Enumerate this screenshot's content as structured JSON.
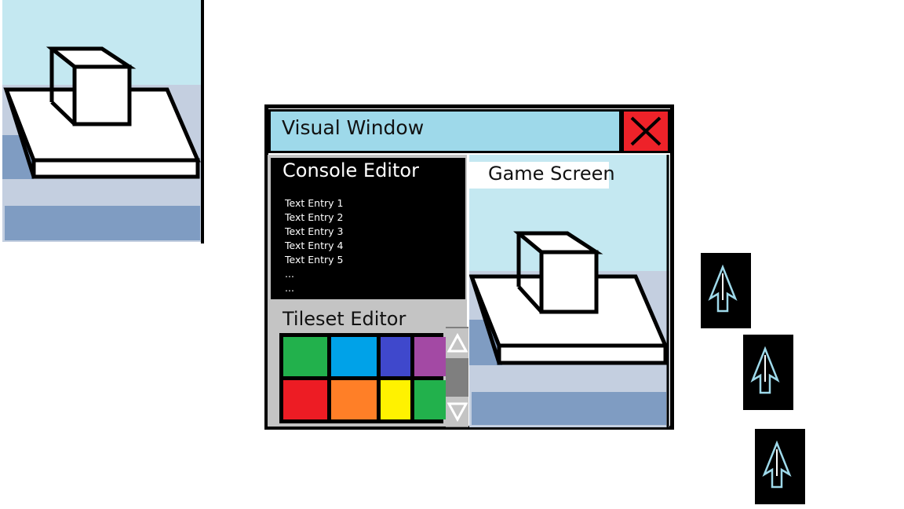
{
  "window": {
    "title": "Visual Window",
    "close_icon": "close-x-icon"
  },
  "console": {
    "title": "Console Editor",
    "entries": [
      "Text Entry 1",
      "Text Entry 2",
      "Text Entry 3",
      "Text Entry 4",
      "Text Entry 5",
      "...",
      "..."
    ]
  },
  "tileset": {
    "title": "Tileset Editor",
    "tiles": [
      "#22b14c",
      "#00a2e8",
      "#3f48cc",
      "#a349a4",
      "#ed1c24",
      "#ff7f27",
      "#fff200",
      "#22b14c"
    ],
    "scroll_up_icon": "triangle-up-icon",
    "scroll_down_icon": "triangle-down-icon"
  },
  "game": {
    "title": "Game Screen"
  },
  "colors": {
    "title_bar": "#9ed9ea",
    "close_button": "#ee2229",
    "sky": "#c4e8f1",
    "floor_light": "#c4cfe0",
    "floor_dark": "#7f9cc2"
  },
  "cursor_icons": [
    "arrow-cursor-icon",
    "arrow-cursor-icon",
    "arrow-cursor-icon"
  ]
}
